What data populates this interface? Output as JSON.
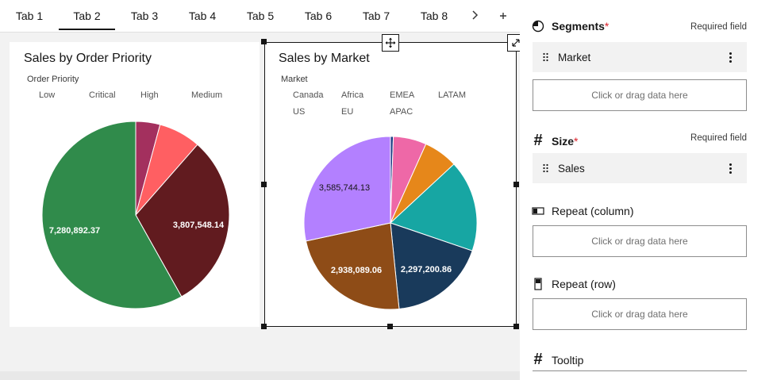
{
  "tabs": [
    {
      "label": "Tab 1",
      "active": false
    },
    {
      "label": "Tab 2",
      "active": true
    },
    {
      "label": "Tab 3",
      "active": false
    },
    {
      "label": "Tab 4",
      "active": false
    },
    {
      "label": "Tab 5",
      "active": false
    },
    {
      "label": "Tab 6",
      "active": false
    },
    {
      "label": "Tab 7",
      "active": false
    },
    {
      "label": "Tab 8",
      "active": false
    }
  ],
  "tab_next_icon": "chevron-right-icon",
  "tab_add_icon": "plus-icon",
  "card1": {
    "title": "Sales by Order Priority",
    "legend_title": "Order Priority",
    "legend": [
      "Low",
      "Critical",
      "High",
      "Medium"
    ]
  },
  "card2": {
    "title": "Sales by Market",
    "legend_title": "Market",
    "legend": [
      "Canada",
      "Africa",
      "EMEA",
      "LATAM",
      "US",
      "EU",
      "APAC"
    ]
  },
  "chart_data": [
    {
      "type": "pie",
      "title": "Sales by Order Priority",
      "legend_title": "Order Priority",
      "categories": [
        "Low",
        "Critical",
        "High",
        "Medium"
      ],
      "values": [
        525000,
        910000,
        3807548.14,
        7280892.37
      ],
      "labels": [
        "",
        "",
        "3,807,548.14",
        "7,280,892.37"
      ],
      "colors": [
        "#a3305e",
        "#ff5f62",
        "#611b1f",
        "#308b4b"
      ],
      "start_angle_deg": 0,
      "direction": "clockwise"
    },
    {
      "type": "pie",
      "title": "Sales by Market",
      "legend_title": "Market",
      "categories": [
        "Canada",
        "Africa",
        "EMEA",
        "LATAM",
        "US",
        "EU",
        "APAC"
      ],
      "values": [
        66900,
        783700,
        806900,
        2164600,
        2297200.86,
        2938089.06,
        3585744.13
      ],
      "labels": [
        "",
        "",
        "",
        "",
        "2,297,200.86",
        "2,938,089.06",
        "3,585,744.13"
      ],
      "colors": [
        "#1b3b82",
        "#ee68a7",
        "#e6871a",
        "#17a6a3",
        "#193a5b",
        "#8e4c17",
        "#b380ff"
      ],
      "start_angle_deg": 0,
      "direction": "clockwise"
    }
  ],
  "panel": {
    "segments": {
      "label": "Segments",
      "star": "*",
      "required": "Required field",
      "icon": "pie-chart-icon",
      "field": "Market",
      "field_icon": "drag-handle-icon",
      "menu_icon": "overflow-menu-icon",
      "drop": "Click or drag data here"
    },
    "size": {
      "label": "Size",
      "star": "*",
      "required": "Required field",
      "icon": "hash-icon",
      "field": "Sales",
      "field_icon": "drag-handle-icon",
      "menu_icon": "overflow-menu-icon"
    },
    "repeat_col": {
      "label": "Repeat (column)",
      "icon": "repeat-column-icon",
      "drop": "Click or drag data here"
    },
    "repeat_row": {
      "label": "Repeat (row)",
      "icon": "repeat-row-icon",
      "drop": "Click or drag data here"
    },
    "tooltip": {
      "label": "Tooltip",
      "icon": "hash-icon"
    }
  }
}
